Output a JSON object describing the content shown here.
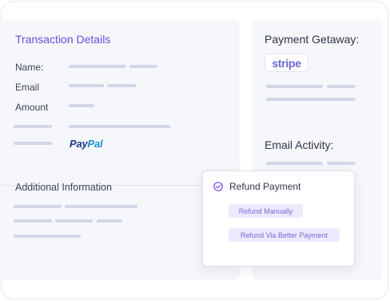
{
  "transaction": {
    "title": "Transaction Details",
    "fields": {
      "name_label": "Name:",
      "email_label": "Email",
      "amount_label": "Amount"
    },
    "payment_logo": {
      "pay": "Pay",
      "pal": "Pal"
    }
  },
  "additional": {
    "title": "Additional Information"
  },
  "gateway": {
    "title": "Payment Getaway:",
    "logo_text": "stripe"
  },
  "email_activity": {
    "title": "Email Activity:"
  },
  "refund_popup": {
    "title": "Refund Payment",
    "icon": "check-circle-icon",
    "options": [
      {
        "label": "Refund Manually"
      },
      {
        "label": "Refund Via Better Payment"
      }
    ]
  },
  "colors": {
    "accent": "#6d4ce0",
    "panel_bg": "#f6f7fb",
    "placeholder_bar": "#d2d7e6",
    "pill_bg": "#eceafc",
    "pill_text": "#7b68d8",
    "stripe": "#6a67d8",
    "paypal_dark": "#1b3a8a",
    "paypal_light": "#1e8fd6"
  }
}
